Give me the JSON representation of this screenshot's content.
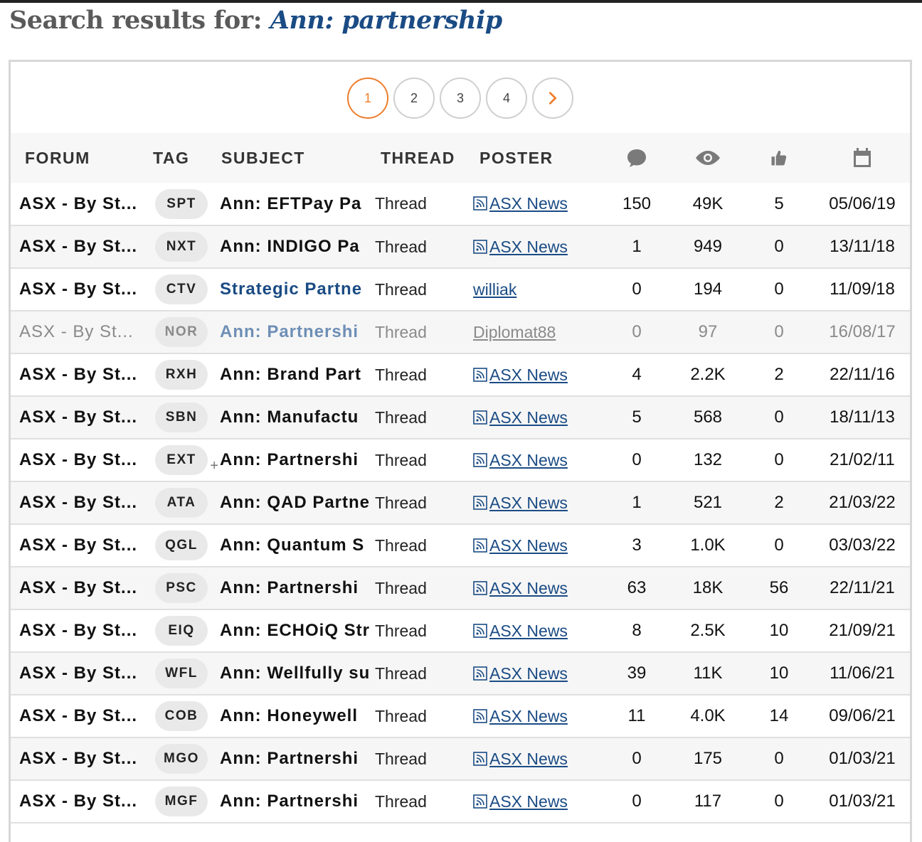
{
  "title": {
    "prefix": "Search results for:",
    "query": "Ann: partnership"
  },
  "pagination": {
    "pages": [
      "1",
      "2",
      "3",
      "4"
    ],
    "active": "1",
    "next_icon": "chevron-right-icon"
  },
  "colors": {
    "accent": "#ef7d2d",
    "link": "#1a4b84"
  },
  "columns": {
    "forum": "FORUM",
    "tag": "TAG",
    "subject": "SUBJECT",
    "thread": "THREAD",
    "poster": "POSTER",
    "replies_icon": "speech-bubble-icon",
    "views_icon": "eye-icon",
    "likes_icon": "thumbs-up-icon",
    "date_icon": "calendar-icon"
  },
  "rows": [
    {
      "forum": "ASX - By St...",
      "tag": "SPT",
      "subject": "Ann: EFTPay Pa",
      "thread": "Thread",
      "poster": "ASX News",
      "rss": true,
      "replies": "150",
      "views": "49K",
      "likes": "5",
      "date": "05/06/19"
    },
    {
      "forum": "ASX - By St...",
      "tag": "NXT",
      "subject": "Ann: INDIGO Pa",
      "thread": "Thread",
      "poster": "ASX News",
      "rss": true,
      "replies": "1",
      "views": "949",
      "likes": "0",
      "date": "13/11/18"
    },
    {
      "forum": "ASX - By St...",
      "tag": "CTV",
      "subject": "Strategic Partne",
      "thread": "Thread",
      "poster": "williak",
      "rss": false,
      "replies": "0",
      "views": "194",
      "likes": "0",
      "date": "11/09/18"
    },
    {
      "forum": "ASX - By St...",
      "tag": "NOR",
      "subject": "Ann: Partnershi",
      "thread": "Thread",
      "poster": "Diplomat88",
      "rss": false,
      "replies": "0",
      "views": "97",
      "likes": "0",
      "date": "16/08/17"
    },
    {
      "forum": "ASX - By St...",
      "tag": "RXH",
      "subject": "Ann: Brand Part",
      "thread": "Thread",
      "poster": "ASX News",
      "rss": true,
      "replies": "4",
      "views": "2.2K",
      "likes": "2",
      "date": "22/11/16"
    },
    {
      "forum": "ASX - By St...",
      "tag": "SBN",
      "subject": "Ann: Manufactu",
      "thread": "Thread",
      "poster": "ASX News",
      "rss": true,
      "replies": "5",
      "views": "568",
      "likes": "0",
      "date": "18/11/13"
    },
    {
      "forum": "ASX - By St...",
      "tag": "EXT",
      "subject": "Ann: Partnershi",
      "thread": "Thread",
      "poster": "ASX News",
      "rss": true,
      "replies": "0",
      "views": "132",
      "likes": "0",
      "date": "21/02/11",
      "plus": "+"
    },
    {
      "forum": "ASX - By St...",
      "tag": "ATA",
      "subject": "Ann: QAD Partne",
      "thread": "Thread",
      "poster": "ASX News",
      "rss": true,
      "replies": "1",
      "views": "521",
      "likes": "2",
      "date": "21/03/22"
    },
    {
      "forum": "ASX - By St...",
      "tag": "QGL",
      "subject": "Ann: Quantum S",
      "thread": "Thread",
      "poster": "ASX News",
      "rss": true,
      "replies": "3",
      "views": "1.0K",
      "likes": "0",
      "date": "03/03/22"
    },
    {
      "forum": "ASX - By St...",
      "tag": "PSC",
      "subject": "Ann: Partnershi",
      "thread": "Thread",
      "poster": "ASX News",
      "rss": true,
      "replies": "63",
      "views": "18K",
      "likes": "56",
      "date": "22/11/21"
    },
    {
      "forum": "ASX - By St...",
      "tag": "EIQ",
      "subject": "Ann: ECHOiQ Str",
      "thread": "Thread",
      "poster": "ASX News",
      "rss": true,
      "replies": "8",
      "views": "2.5K",
      "likes": "10",
      "date": "21/09/21"
    },
    {
      "forum": "ASX - By St...",
      "tag": "WFL",
      "subject": "Ann: Wellfully su",
      "thread": "Thread",
      "poster": "ASX News",
      "rss": true,
      "replies": "39",
      "views": "11K",
      "likes": "10",
      "date": "11/06/21"
    },
    {
      "forum": "ASX - By St...",
      "tag": "COB",
      "subject": "Ann: Honeywell",
      "thread": "Thread",
      "poster": "ASX News",
      "rss": true,
      "replies": "11",
      "views": "4.0K",
      "likes": "14",
      "date": "09/06/21"
    },
    {
      "forum": "ASX - By St...",
      "tag": "MGO",
      "subject": "Ann: Partnershi",
      "thread": "Thread",
      "poster": "ASX News",
      "rss": true,
      "replies": "0",
      "views": "175",
      "likes": "0",
      "date": "01/03/21"
    },
    {
      "forum": "ASX - By St...",
      "tag": "MGF",
      "subject": "Ann: Partnershi",
      "thread": "Thread",
      "poster": "ASX News",
      "rss": true,
      "replies": "0",
      "views": "117",
      "likes": "0",
      "date": "01/03/21"
    }
  ]
}
